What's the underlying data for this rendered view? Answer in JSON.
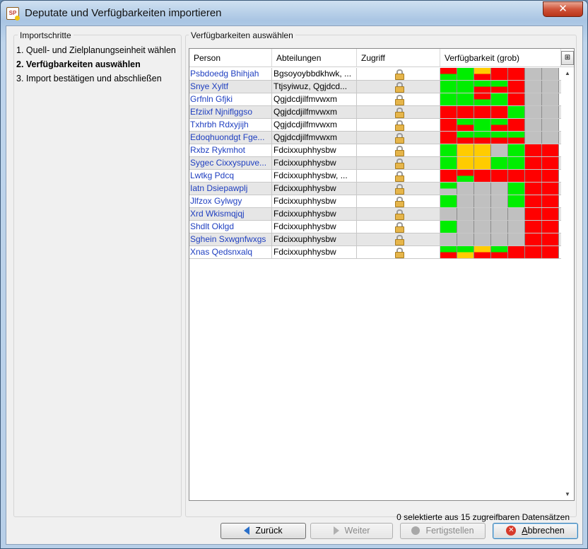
{
  "window": {
    "title": "Deputate und Verfügbarkeiten importieren",
    "close_label": "✕",
    "app_icon": "SP"
  },
  "steps": {
    "title": "Importschritte",
    "items": [
      {
        "label": "1. Quell- und Zielplanungseinheit wählen",
        "active": false
      },
      {
        "label": "2. Verfügbarkeiten auswählen",
        "active": true
      },
      {
        "label": "3. Import bestätigen und abschließen",
        "active": false
      }
    ]
  },
  "availability": {
    "title": "Verfügbarkeiten auswählen",
    "columns": [
      "Person",
      "Abteilungen",
      "Zugriff",
      "Verfügbarkeit (grob)"
    ],
    "colors": {
      "G": "#00ee00",
      "R": "#ff0000",
      "Y": "#ffcc00",
      "S": "#c0c0c0"
    },
    "rows": [
      {
        "person": "Psbdoedg Bhihjah",
        "dept": "Bgsoyoybbdkhwk, ...",
        "blocks": [
          "RG",
          "GG",
          "YR",
          "RR",
          "RR",
          "SS",
          "SS"
        ]
      },
      {
        "person": "Snye Xyltf",
        "dept": "Ttjsyiwuz, Qgjdcd...",
        "blocks": [
          "GG",
          "GG",
          "GR",
          "GR",
          "RR",
          "SS",
          "SS"
        ]
      },
      {
        "person": "Grfnln Gfjki",
        "dept": "Qgjdcdjilfmvwxm",
        "blocks": [
          "GG",
          "GG",
          "RG",
          "GG",
          "RR",
          "SS",
          "SS"
        ]
      },
      {
        "person": "Efziixf Njniflggso",
        "dept": "Qgjdcdjilfmvwxm",
        "blocks": [
          "RR",
          "RR",
          "RR",
          "RR",
          "GG",
          "SS",
          "SS"
        ]
      },
      {
        "person": "Txhrbh Rdxyjijh",
        "dept": "Qgjdcdjilfmvwxm",
        "blocks": [
          "RR",
          "GR",
          "GG",
          "GR",
          "RR",
          "SS",
          "SS"
        ]
      },
      {
        "person": "Edoqhuondgt Fge...",
        "dept": "Qgjdcdjilfmvwxm",
        "blocks": [
          "RR",
          "GR",
          "GR",
          "GR",
          "GR",
          "SS",
          "SS"
        ]
      },
      {
        "person": "Rxbz Rykmhot",
        "dept": "Fdcixxuphhysbw",
        "blocks": [
          "GG",
          "YY",
          "YY",
          "SS",
          "GG",
          "RR",
          "RR"
        ]
      },
      {
        "person": "Sygec Cixxyspuve...",
        "dept": "Fdcixxuphhysbw",
        "blocks": [
          "GG",
          "YY",
          "YY",
          "GG",
          "GG",
          "RR",
          "RR"
        ]
      },
      {
        "person": "Lwtkg Pdcq",
        "dept": "Fdcixxuphhysbw, ...",
        "blocks": [
          "RR",
          "RG",
          "RR",
          "RR",
          "RR",
          "RR",
          "RR"
        ]
      },
      {
        "person": "Iatn Dsiepawplj",
        "dept": "Fdcixxuphhysbw",
        "blocks": [
          "GS",
          "SS",
          "SS",
          "SS",
          "GG",
          "RR",
          "RR"
        ]
      },
      {
        "person": "Jlfzox Gylwgy",
        "dept": "Fdcixxuphhysbw",
        "blocks": [
          "GG",
          "SS",
          "SS",
          "SS",
          "GG",
          "RR",
          "RR"
        ]
      },
      {
        "person": "Xrd Wkismqjqj",
        "dept": "Fdcixxuphhysbw",
        "blocks": [
          "SS",
          "SS",
          "SS",
          "SS",
          "SS",
          "RR",
          "RR"
        ]
      },
      {
        "person": "Shdlt Oklgd",
        "dept": "Fdcixxuphhysbw",
        "blocks": [
          "GG",
          "SS",
          "SS",
          "SS",
          "SS",
          "RR",
          "RR"
        ]
      },
      {
        "person": "Sghein Sxwgnfwxgs",
        "dept": "Fdcixxuphhysbw",
        "blocks": [
          "SS",
          "SS",
          "SS",
          "SS",
          "SS",
          "RR",
          "RR"
        ]
      },
      {
        "person": "Xnas Qedsnxalq",
        "dept": "Fdcixxuphhysbw",
        "blocks": [
          "GR",
          "GY",
          "YR",
          "GR",
          "RR",
          "RR",
          "RR"
        ]
      }
    ],
    "status": "0 selektierte aus 15 zugreifbaren Datensätzen"
  },
  "buttons": {
    "back": "Zurück",
    "next": "Weiter",
    "finish": "Fertigstellen",
    "cancel_prefix": "",
    "cancel_accel": "A",
    "cancel_rest": "bbrechen"
  }
}
